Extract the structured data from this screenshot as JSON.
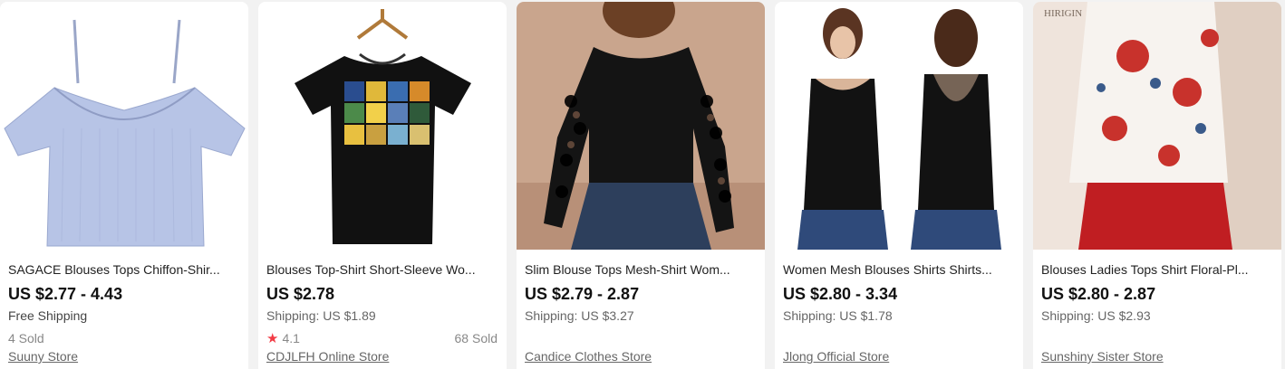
{
  "products": [
    {
      "title": "SAGACE Blouses Tops Chiffon-Shir...",
      "price": "US $2.77 - 4.43",
      "shipping": "Free Shipping",
      "sold": "4 Sold",
      "rating": "",
      "store": "Suuny Store",
      "image": "light-blue-off-shoulder-blouse"
    },
    {
      "title": "Blouses Top-Shirt Short-Sleeve Wo...",
      "price": "US $2.78",
      "shipping": "Shipping: US $1.89",
      "sold": "68 Sold",
      "rating": "4.1",
      "store": "CDJLFH Online Store",
      "image": "black-tshirt-van-gogh-print"
    },
    {
      "title": "Slim Blouse Tops Mesh-Shirt Wom...",
      "price": "US $2.79 - 2.87",
      "shipping": "Shipping: US $3.27",
      "sold": "",
      "rating": "",
      "store": "Candice Clothes Store",
      "image": "black-polka-dot-mesh-top"
    },
    {
      "title": "Women Mesh Blouses Shirts Shirts...",
      "price": "US $2.80 - 3.34",
      "shipping": "Shipping: US $1.78",
      "sold": "",
      "rating": "",
      "store": "Jlong Official Store",
      "image": "black-mesh-tank-front-back"
    },
    {
      "title": "Blouses Ladies Tops Shirt Floral-Pl...",
      "price": "US $2.80 - 2.87",
      "shipping": "Shipping: US $2.93",
      "sold": "",
      "rating": "",
      "store": "Sunshiny Sister Store",
      "image": "floral-halter-blouse",
      "watermark": "HIRIGIN"
    }
  ]
}
